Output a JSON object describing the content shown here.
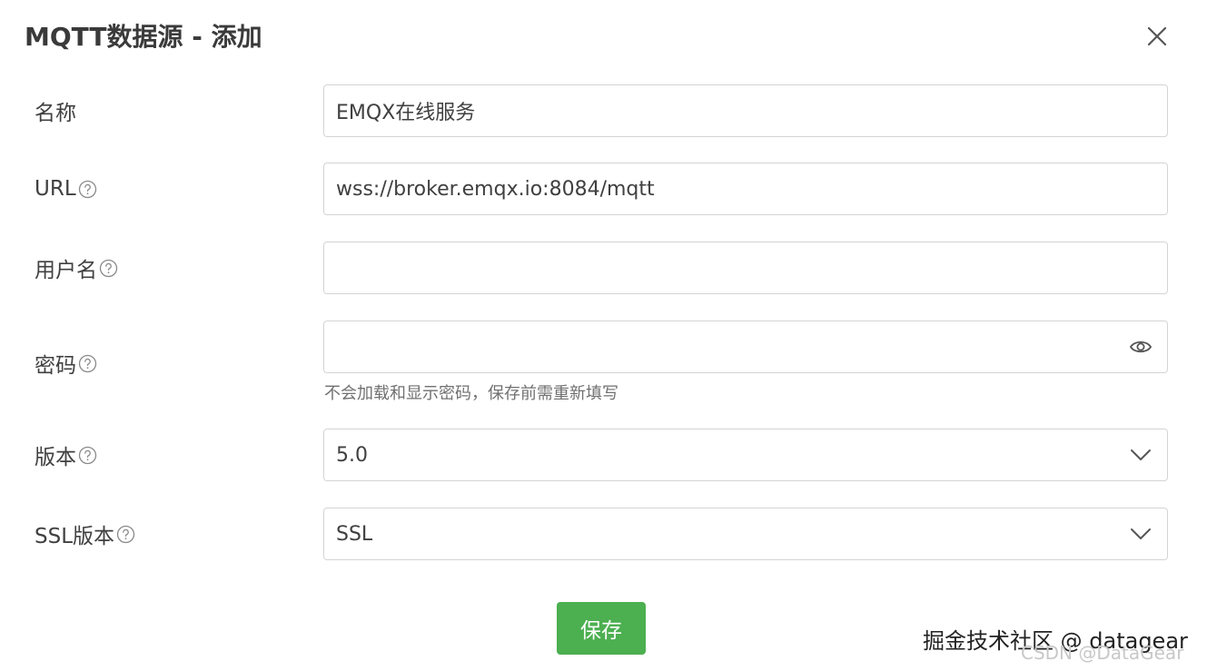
{
  "dialog": {
    "title": "MQTT数据源 - 添加",
    "close_icon": "close-icon"
  },
  "form": {
    "name": {
      "label": "名称",
      "value": "EMQX在线服务"
    },
    "url": {
      "label": "URL",
      "value": "wss://broker.emqx.io:8084/mqtt",
      "help_icon": "question-circle-icon"
    },
    "username": {
      "label": "用户名",
      "value": "",
      "help_icon": "question-circle-icon"
    },
    "password": {
      "label": "密码",
      "value": "",
      "help_icon": "question-circle-icon",
      "toggle_icon": "eye-icon",
      "hint": "不会加载和显示密码，保存前需重新填写"
    },
    "version": {
      "label": "版本",
      "selected": "5.0",
      "help_icon": "question-circle-icon",
      "arrow_icon": "chevron-down-icon"
    },
    "ssl_version": {
      "label": "SSL版本",
      "selected": "SSL",
      "help_icon": "question-circle-icon",
      "arrow_icon": "chevron-down-icon"
    }
  },
  "actions": {
    "save_label": "保存"
  },
  "watermark": {
    "line1": "掘金技术社区 @ datagear",
    "line2": "CSDN @DataGear"
  },
  "colors": {
    "primary": "#4caf50",
    "border": "#d4d4d4",
    "text": "#404040",
    "hint": "#707070"
  }
}
